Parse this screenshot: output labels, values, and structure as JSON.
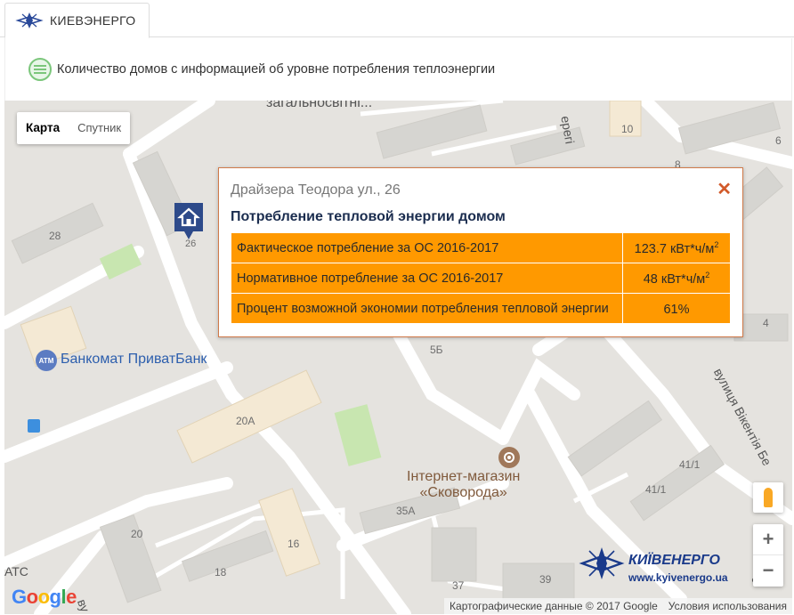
{
  "tab": {
    "label": "КИЕВЭНЕРГО",
    "logo_icon": "kyivenergo-logo-icon"
  },
  "legend": {
    "icon": "list-circle-icon",
    "text": "Количество домов с информацией об уровне потребления теплоэнергии"
  },
  "map": {
    "type_buttons": {
      "map": "Карта",
      "satellite": "Спутник"
    },
    "labels": {
      "top_street": "загальносвітні...",
      "street_right": "ерегі",
      "n10": "10",
      "n6": "6",
      "n8": "8",
      "n28": "28",
      "n26": "26",
      "n4": "4",
      "n5b": "5Б",
      "n20a": "20А",
      "n41_1a": "41/1",
      "n41_1b": "41/1",
      "n35a": "35А",
      "n20": "20",
      "n16": "16",
      "n18": "18",
      "n37": "37",
      "n39": "39",
      "street_vikentia": "вулиця Вікентія Бе",
      "left_atc": "АТС",
      "left_vu": "ву",
      "bottom_right_street": "ськ"
    },
    "atm": {
      "icon_text": "ATM",
      "label": "Банкомат ПриватБанк"
    },
    "shop": {
      "label_line1": "Інтернет-магазин",
      "label_line2": "«Сковорода»"
    },
    "brand": {
      "name": "КИЇВЕНЕРГО",
      "url": "www.kyivenergo.ua"
    },
    "google": {
      "text": "Google"
    },
    "attribution": {
      "data": "Картографические данные © 2017 Google",
      "terms": "Условия использования"
    },
    "zoom": {
      "in": "+",
      "out": "−"
    }
  },
  "popup": {
    "address": "Драйзера Теодора ул., 26",
    "close": "✕",
    "title": "Потребление тепловой энергии домом",
    "rows": [
      {
        "label": "Фактическое потребление за ОС 2016-2017",
        "value": "123.7 кВт*ч/м",
        "sup": "2"
      },
      {
        "label": "Нормативное потребление за ОС 2016-2017",
        "value": "48 кВт*ч/м",
        "sup": "2"
      },
      {
        "label": "Процент возможной экономии потребления тепловой энергии",
        "value": "61%",
        "sup": ""
      }
    ]
  },
  "colors": {
    "accent_orange": "#ff9900",
    "popup_border": "#d07a4a",
    "title_navy": "#1b2d4f"
  }
}
